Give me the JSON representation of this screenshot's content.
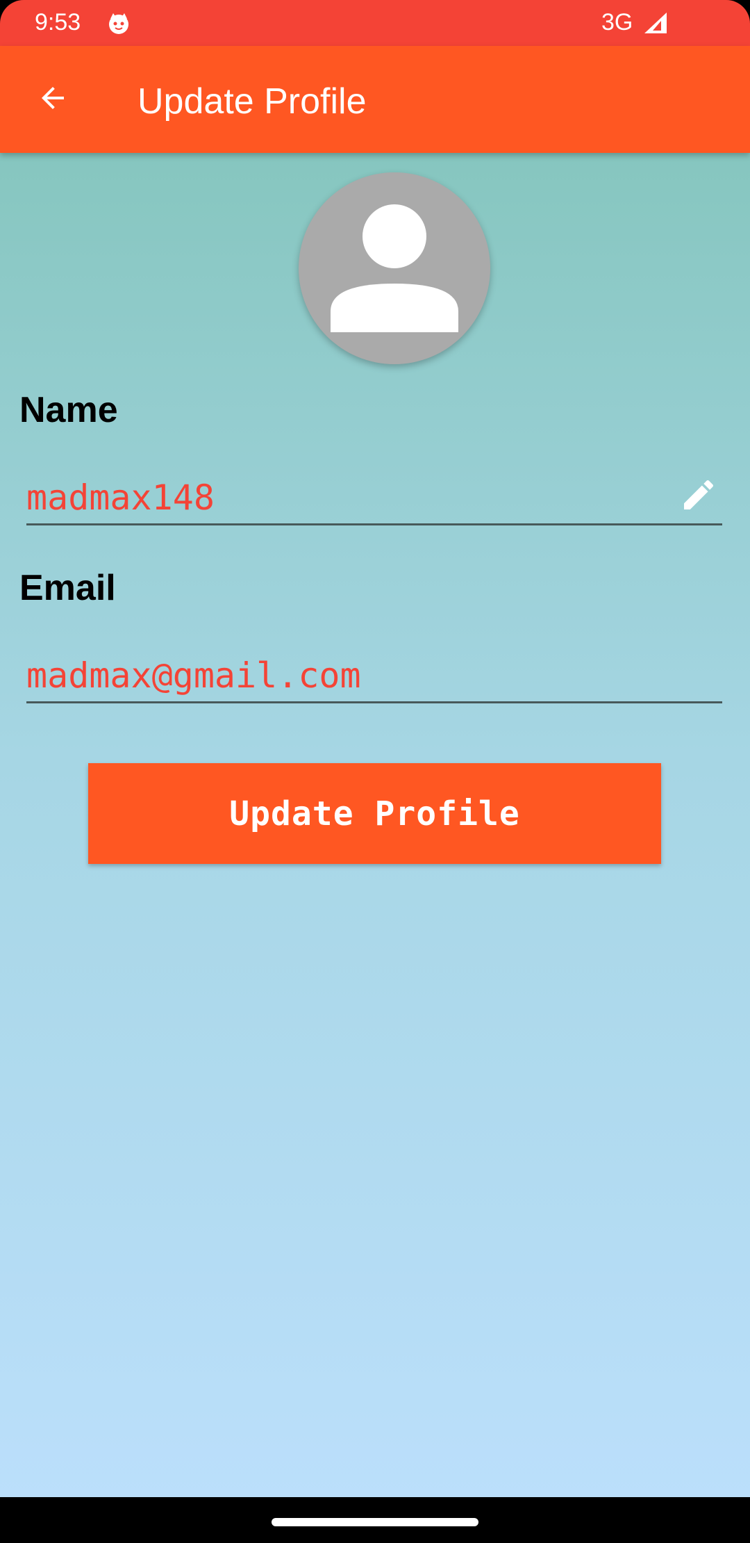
{
  "status_bar": {
    "time": "9:53",
    "network": "3G",
    "app_icon": "cat-face-icon",
    "signal_icon": "signal-icon",
    "color": "#f44336"
  },
  "app_bar": {
    "title": "Update Profile",
    "back_icon": "arrow-back-icon",
    "color": "#ff5722"
  },
  "profile": {
    "avatar_icon": "person-icon",
    "name_label": "Name",
    "name_value": "madmax148",
    "name_edit_icon": "pencil-icon",
    "email_label": "Email",
    "email_value": "madmax@gmail.com"
  },
  "actions": {
    "update_button_label": "Update Profile"
  },
  "colors": {
    "accent": "#ff5722",
    "input_text": "#f44336",
    "gradient_top": "#86c6bf",
    "gradient_bottom": "#bbdffb"
  }
}
